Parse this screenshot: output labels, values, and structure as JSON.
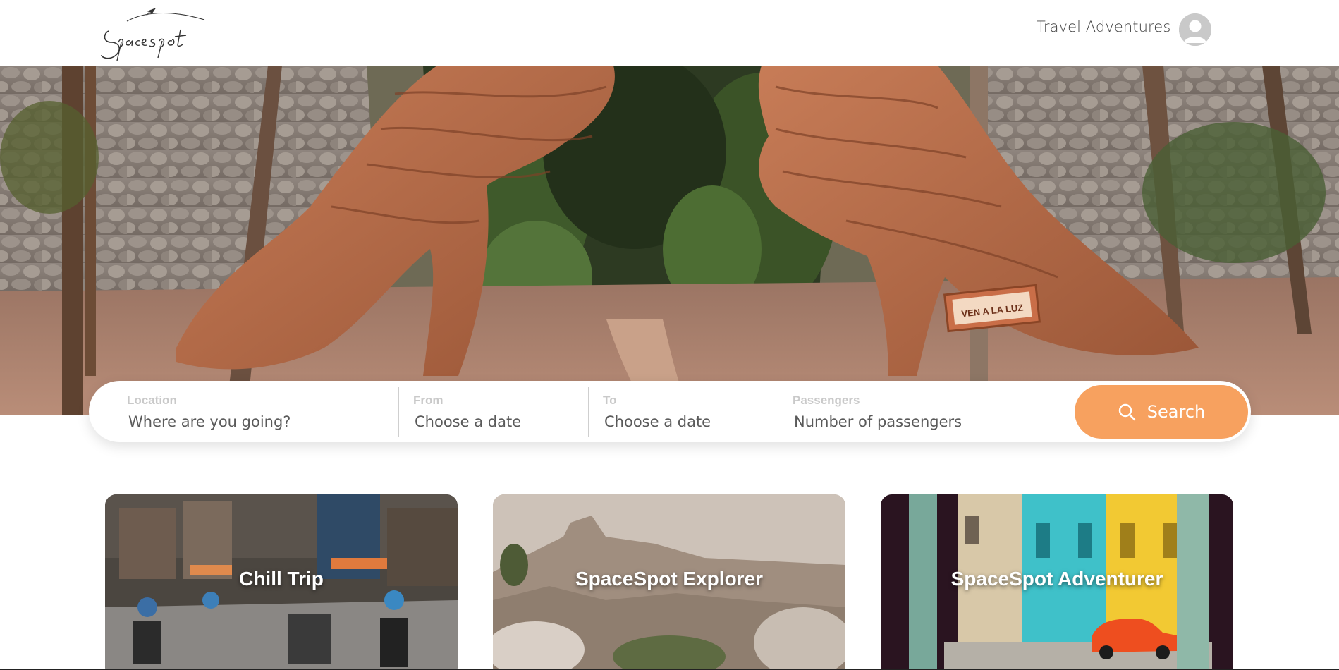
{
  "header": {
    "logo_text": "Spacespot",
    "nav_link": "Travel Adventures",
    "avatar_icon": "user-avatar-icon"
  },
  "hero": {
    "sign_line1": "VEN A LA LUZ"
  },
  "search": {
    "location_label": "Location",
    "location_placeholder": "Where are you going?",
    "from_label": "From",
    "from_placeholder": "Choose a date",
    "to_label": "To",
    "to_placeholder": "Choose a date",
    "passengers_label": "Passengers",
    "passengers_placeholder": "Number of passengers",
    "button_label": "Search",
    "button_icon": "search-icon"
  },
  "cards": [
    {
      "title": "Chill Trip"
    },
    {
      "title": "SpaceSpot Explorer"
    },
    {
      "title": "SpaceSpot Adventurer"
    }
  ],
  "colors": {
    "accent": "#f7a15f",
    "text": "#444444",
    "label": "#c9c9c9"
  }
}
